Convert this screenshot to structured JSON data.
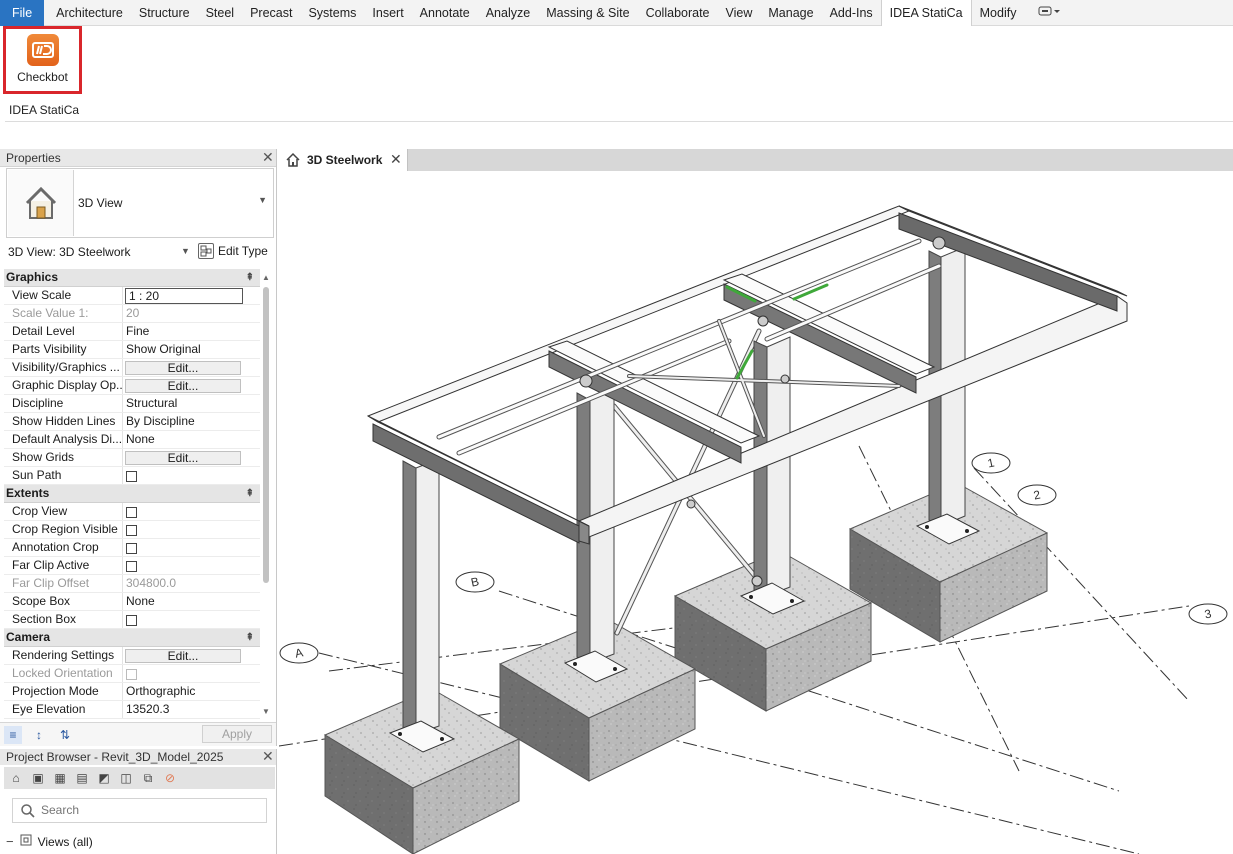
{
  "ribbon": {
    "tabs": [
      "File",
      "Architecture",
      "Structure",
      "Steel",
      "Precast",
      "Systems",
      "Insert",
      "Annotate",
      "Analyze",
      "Massing & Site",
      "Collaborate",
      "View",
      "Manage",
      "Add-Ins",
      "IDEA StatiCa",
      "Modify"
    ],
    "active_tab": "IDEA StatiCa",
    "checkbot_label": "Checkbot",
    "panel_name": "IDEA StatiCa",
    "accent": "#d9262b",
    "file_color": "#2a74c2"
  },
  "properties": {
    "title": "Properties",
    "type_name": "3D View",
    "instance": "3D View: 3D Steelwork",
    "edit_type": "Edit Type",
    "groups": {
      "graphics": "Graphics",
      "extents": "Extents",
      "camera": "Camera"
    },
    "graphics": [
      {
        "k": "View Scale",
        "v": "1 : 20",
        "kind": "box"
      },
      {
        "k": "Scale Value    1:",
        "v": "20",
        "kind": "dim"
      },
      {
        "k": "Detail Level",
        "v": "Fine"
      },
      {
        "k": "Parts Visibility",
        "v": "Show Original"
      },
      {
        "k": "Visibility/Graphics ...",
        "v": "Edit...",
        "kind": "btn"
      },
      {
        "k": "Graphic Display Op...",
        "v": "Edit...",
        "kind": "btn"
      },
      {
        "k": "Discipline",
        "v": "Structural"
      },
      {
        "k": "Show Hidden Lines",
        "v": "By Discipline"
      },
      {
        "k": "Default Analysis Di...",
        "v": "None"
      },
      {
        "k": "Show Grids",
        "v": "Edit...",
        "kind": "btn"
      },
      {
        "k": "Sun Path",
        "v": "",
        "kind": "cb"
      }
    ],
    "extents": [
      {
        "k": "Crop View",
        "v": "",
        "kind": "cb"
      },
      {
        "k": "Crop Region Visible",
        "v": "",
        "kind": "cb"
      },
      {
        "k": "Annotation Crop",
        "v": "",
        "kind": "cb"
      },
      {
        "k": "Far Clip Active",
        "v": "",
        "kind": "cb"
      },
      {
        "k": "Far Clip Offset",
        "v": "304800.0",
        "kind": "dim"
      },
      {
        "k": "Scope Box",
        "v": "None"
      },
      {
        "k": "Section Box",
        "v": "",
        "kind": "cb"
      }
    ],
    "camera": [
      {
        "k": "Rendering Settings",
        "v": "Edit...",
        "kind": "btn"
      },
      {
        "k": "Locked Orientation",
        "v": "",
        "kind": "dimcb"
      },
      {
        "k": "Projection Mode",
        "v": "Orthographic"
      },
      {
        "k": "Eye Elevation",
        "v": "13520.3"
      }
    ],
    "apply": "Apply"
  },
  "browser": {
    "title": "Project Browser - Revit_3D_Model_2025",
    "search_placeholder": "Search",
    "tree_root": "Views (all)"
  },
  "view": {
    "tab_label": "3D Steelwork",
    "grid_labels": [
      "A",
      "B",
      "1",
      "2",
      "3"
    ]
  }
}
